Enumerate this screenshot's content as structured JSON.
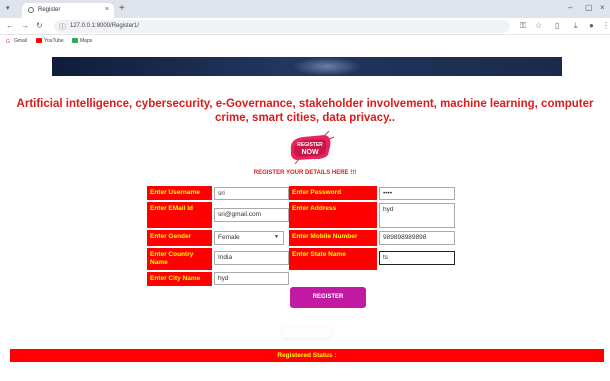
{
  "browser": {
    "tab_title": "Register",
    "tab_close": "×",
    "new_tab": "+",
    "url": "127.0.0.1:8000/Register1/",
    "window_controls": [
      "–",
      "▢",
      "×"
    ],
    "bookmarks": [
      {
        "label": "Gmail",
        "color": "#ea4335"
      },
      {
        "label": "YouTube",
        "color": "#ff0000"
      },
      {
        "label": "Maps",
        "color": "#34a853"
      }
    ]
  },
  "page": {
    "headline": "Artificial intelligence, cybersecurity, e-Governance, stakeholder involvement, machine learning, computer crime, smart cities, data privacy..",
    "register_now_badge": "REGISTER NOW",
    "register_subtitle": "REGISTER YOUR DETAILS HERE !!!",
    "colors": {
      "label_bg": "#ff0000",
      "label_text": "#ffff00",
      "button_bg": "#c21aa3",
      "headline": "#d91c1c"
    }
  },
  "form": {
    "username": {
      "label": "Enter Username",
      "value": "sri"
    },
    "password": {
      "label": "Enter Password",
      "value": "••••"
    },
    "email": {
      "label": "Enter EMail Id",
      "value": "sri@gmail.com"
    },
    "address": {
      "label": "Enter Address",
      "value": "hyd"
    },
    "gender": {
      "label": "Enter Gender",
      "value": "Female"
    },
    "mobile": {
      "label": "Enter Mobile Number",
      "value": "989898989898"
    },
    "country": {
      "label": "Enter Country Name",
      "value": "India"
    },
    "state": {
      "label": "Enter State Name",
      "value": "ts"
    },
    "city": {
      "label": "Enter City Name",
      "value": "hyd"
    },
    "submit_label": "REGISTER"
  },
  "status": {
    "text": "Registered Status :"
  }
}
